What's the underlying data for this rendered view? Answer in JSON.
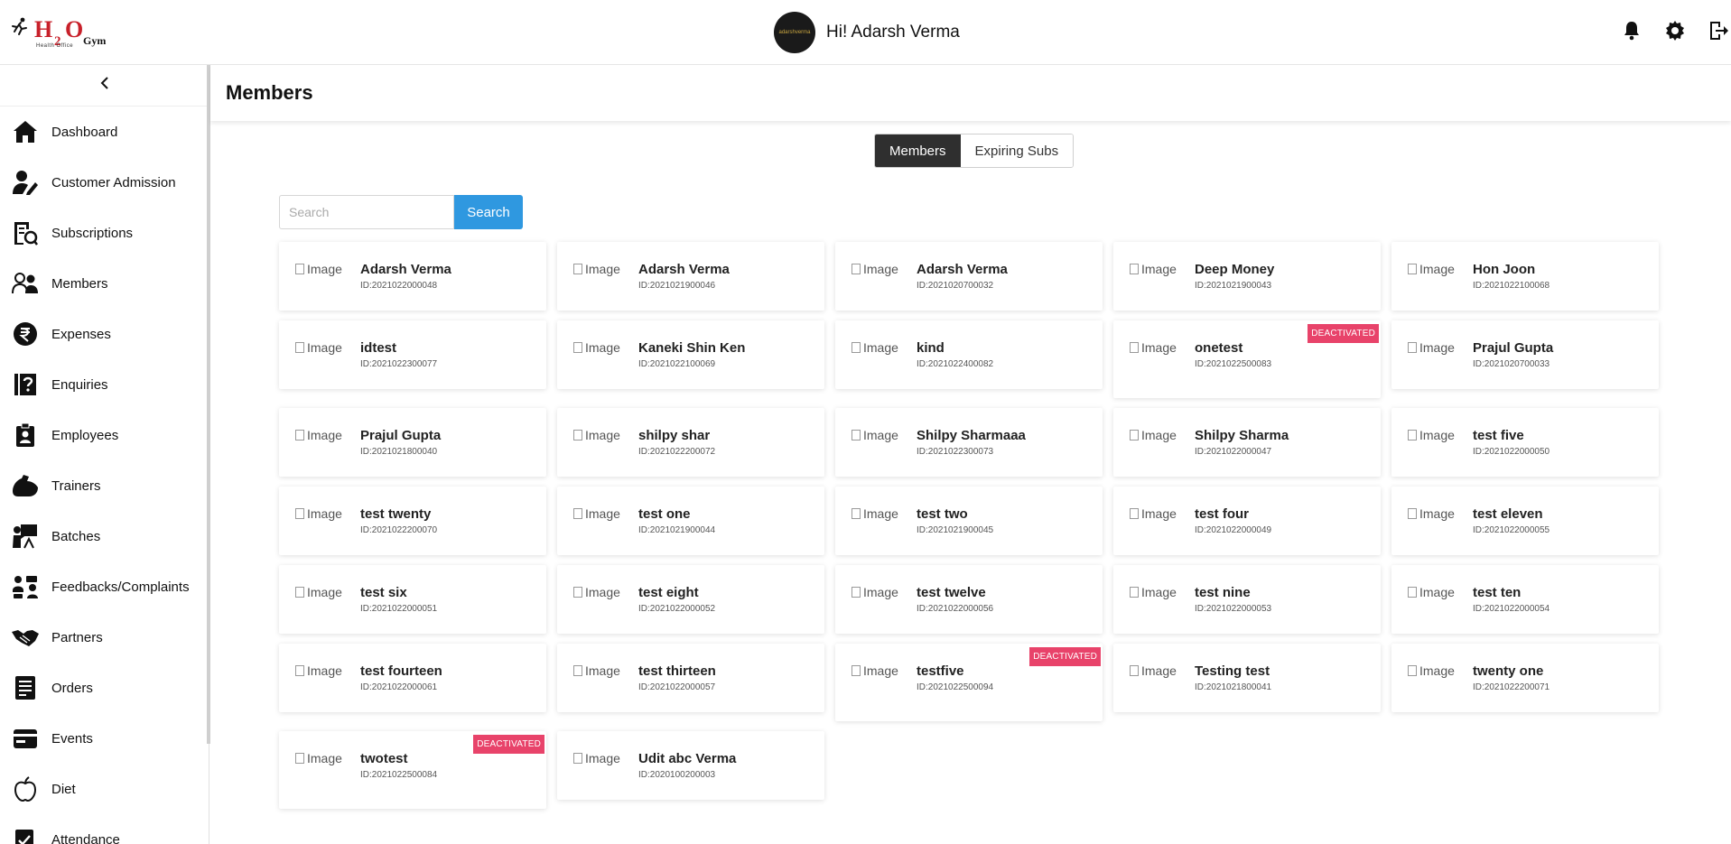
{
  "header": {
    "logo": {
      "h": "H",
      "two": "2",
      "o": "O",
      "gym": "Gym",
      "tagline": "Health Office"
    },
    "avatar_text": "adarshverma",
    "greeting": "Hi! Adarsh Verma",
    "icons": [
      "bell-icon",
      "gear-icon",
      "logout-icon"
    ]
  },
  "sidebar": {
    "collapse_icon": "chevron-left-icon",
    "items": [
      {
        "label": "Dashboard",
        "icon": "home-icon"
      },
      {
        "label": "Customer Admission",
        "icon": "user-edit-icon"
      },
      {
        "label": "Subscriptions",
        "icon": "subscriptions-icon"
      },
      {
        "label": "Members",
        "icon": "users-icon"
      },
      {
        "label": "Expenses",
        "icon": "rupee-icon"
      },
      {
        "label": "Enquiries",
        "icon": "question-book-icon"
      },
      {
        "label": "Employees",
        "icon": "badge-icon"
      },
      {
        "label": "Trainers",
        "icon": "muscle-icon"
      },
      {
        "label": "Batches",
        "icon": "teacher-icon"
      },
      {
        "label": "Feedbacks/Complaints",
        "icon": "people-feedback-icon"
      },
      {
        "label": "Partners",
        "icon": "handshake-icon"
      },
      {
        "label": "Orders",
        "icon": "orders-icon"
      },
      {
        "label": "Events",
        "icon": "event-card-icon"
      },
      {
        "label": "Diet",
        "icon": "apple-icon"
      },
      {
        "label": "Attendance",
        "icon": "attendance-icon"
      }
    ]
  },
  "main": {
    "title": "Members",
    "tabs": [
      {
        "label": "Members",
        "active": true
      },
      {
        "label": "Expiring Subs",
        "active": false
      }
    ],
    "search": {
      "placeholder": "Search",
      "value": "",
      "button": "Search"
    },
    "image_alt": "Image",
    "badge_text": "DEACTIVATED",
    "members": [
      {
        "name": "Adarsh Verma",
        "id": "ID:2021022000048",
        "deactivated": false
      },
      {
        "name": "Adarsh Verma",
        "id": "ID:2021021900046",
        "deactivated": false
      },
      {
        "name": "Adarsh Verma",
        "id": "ID:2021020700032",
        "deactivated": false
      },
      {
        "name": "Deep Money",
        "id": "ID:2021021900043",
        "deactivated": false
      },
      {
        "name": "Hon Joon",
        "id": "ID:2021022100068",
        "deactivated": false
      },
      {
        "name": "idtest",
        "id": "ID:2021022300077",
        "deactivated": false
      },
      {
        "name": "Kaneki Shin Ken",
        "id": "ID:2021022100069",
        "deactivated": false
      },
      {
        "name": "kind",
        "id": "ID:2021022400082",
        "deactivated": false
      },
      {
        "name": "onetest",
        "id": "ID:2021022500083",
        "deactivated": true
      },
      {
        "name": "Prajul Gupta",
        "id": "ID:2021020700033",
        "deactivated": false
      },
      {
        "name": "Prajul Gupta",
        "id": "ID:2021021800040",
        "deactivated": false
      },
      {
        "name": "shilpy shar",
        "id": "ID:2021022200072",
        "deactivated": false
      },
      {
        "name": "Shilpy Sharmaaa",
        "id": "ID:2021022300073",
        "deactivated": false
      },
      {
        "name": "Shilpy Sharma",
        "id": "ID:2021022000047",
        "deactivated": false
      },
      {
        "name": "test five",
        "id": "ID:2021022000050",
        "deactivated": false
      },
      {
        "name": "test twenty",
        "id": "ID:2021022200070",
        "deactivated": false
      },
      {
        "name": "test one",
        "id": "ID:2021021900044",
        "deactivated": false
      },
      {
        "name": "test two",
        "id": "ID:2021021900045",
        "deactivated": false
      },
      {
        "name": "test four",
        "id": "ID:2021022000049",
        "deactivated": false
      },
      {
        "name": "test eleven",
        "id": "ID:2021022000055",
        "deactivated": false
      },
      {
        "name": "test six",
        "id": "ID:2021022000051",
        "deactivated": false
      },
      {
        "name": "test eight",
        "id": "ID:2021022000052",
        "deactivated": false
      },
      {
        "name": "test twelve",
        "id": "ID:2021022000056",
        "deactivated": false
      },
      {
        "name": "test nine",
        "id": "ID:2021022000053",
        "deactivated": false
      },
      {
        "name": "test ten",
        "id": "ID:2021022000054",
        "deactivated": false
      },
      {
        "name": "test fourteen",
        "id": "ID:2021022000061",
        "deactivated": false
      },
      {
        "name": "test thirteen",
        "id": "ID:2021022000057",
        "deactivated": false
      },
      {
        "name": "testfive",
        "id": "ID:2021022500094",
        "deactivated": true
      },
      {
        "name": "Testing test",
        "id": "ID:2021021800041",
        "deactivated": false
      },
      {
        "name": "twenty one",
        "id": "ID:2021022200071",
        "deactivated": false
      },
      {
        "name": "twotest",
        "id": "ID:2021022500084",
        "deactivated": true
      },
      {
        "name": "Udit abc Verma",
        "id": "ID:2020100200003",
        "deactivated": false
      }
    ]
  },
  "colors": {
    "search_button": "#2f98e0",
    "badge": "#e8436a",
    "active_tab": "#2f2f2f",
    "logo_red": "#c8202a"
  }
}
